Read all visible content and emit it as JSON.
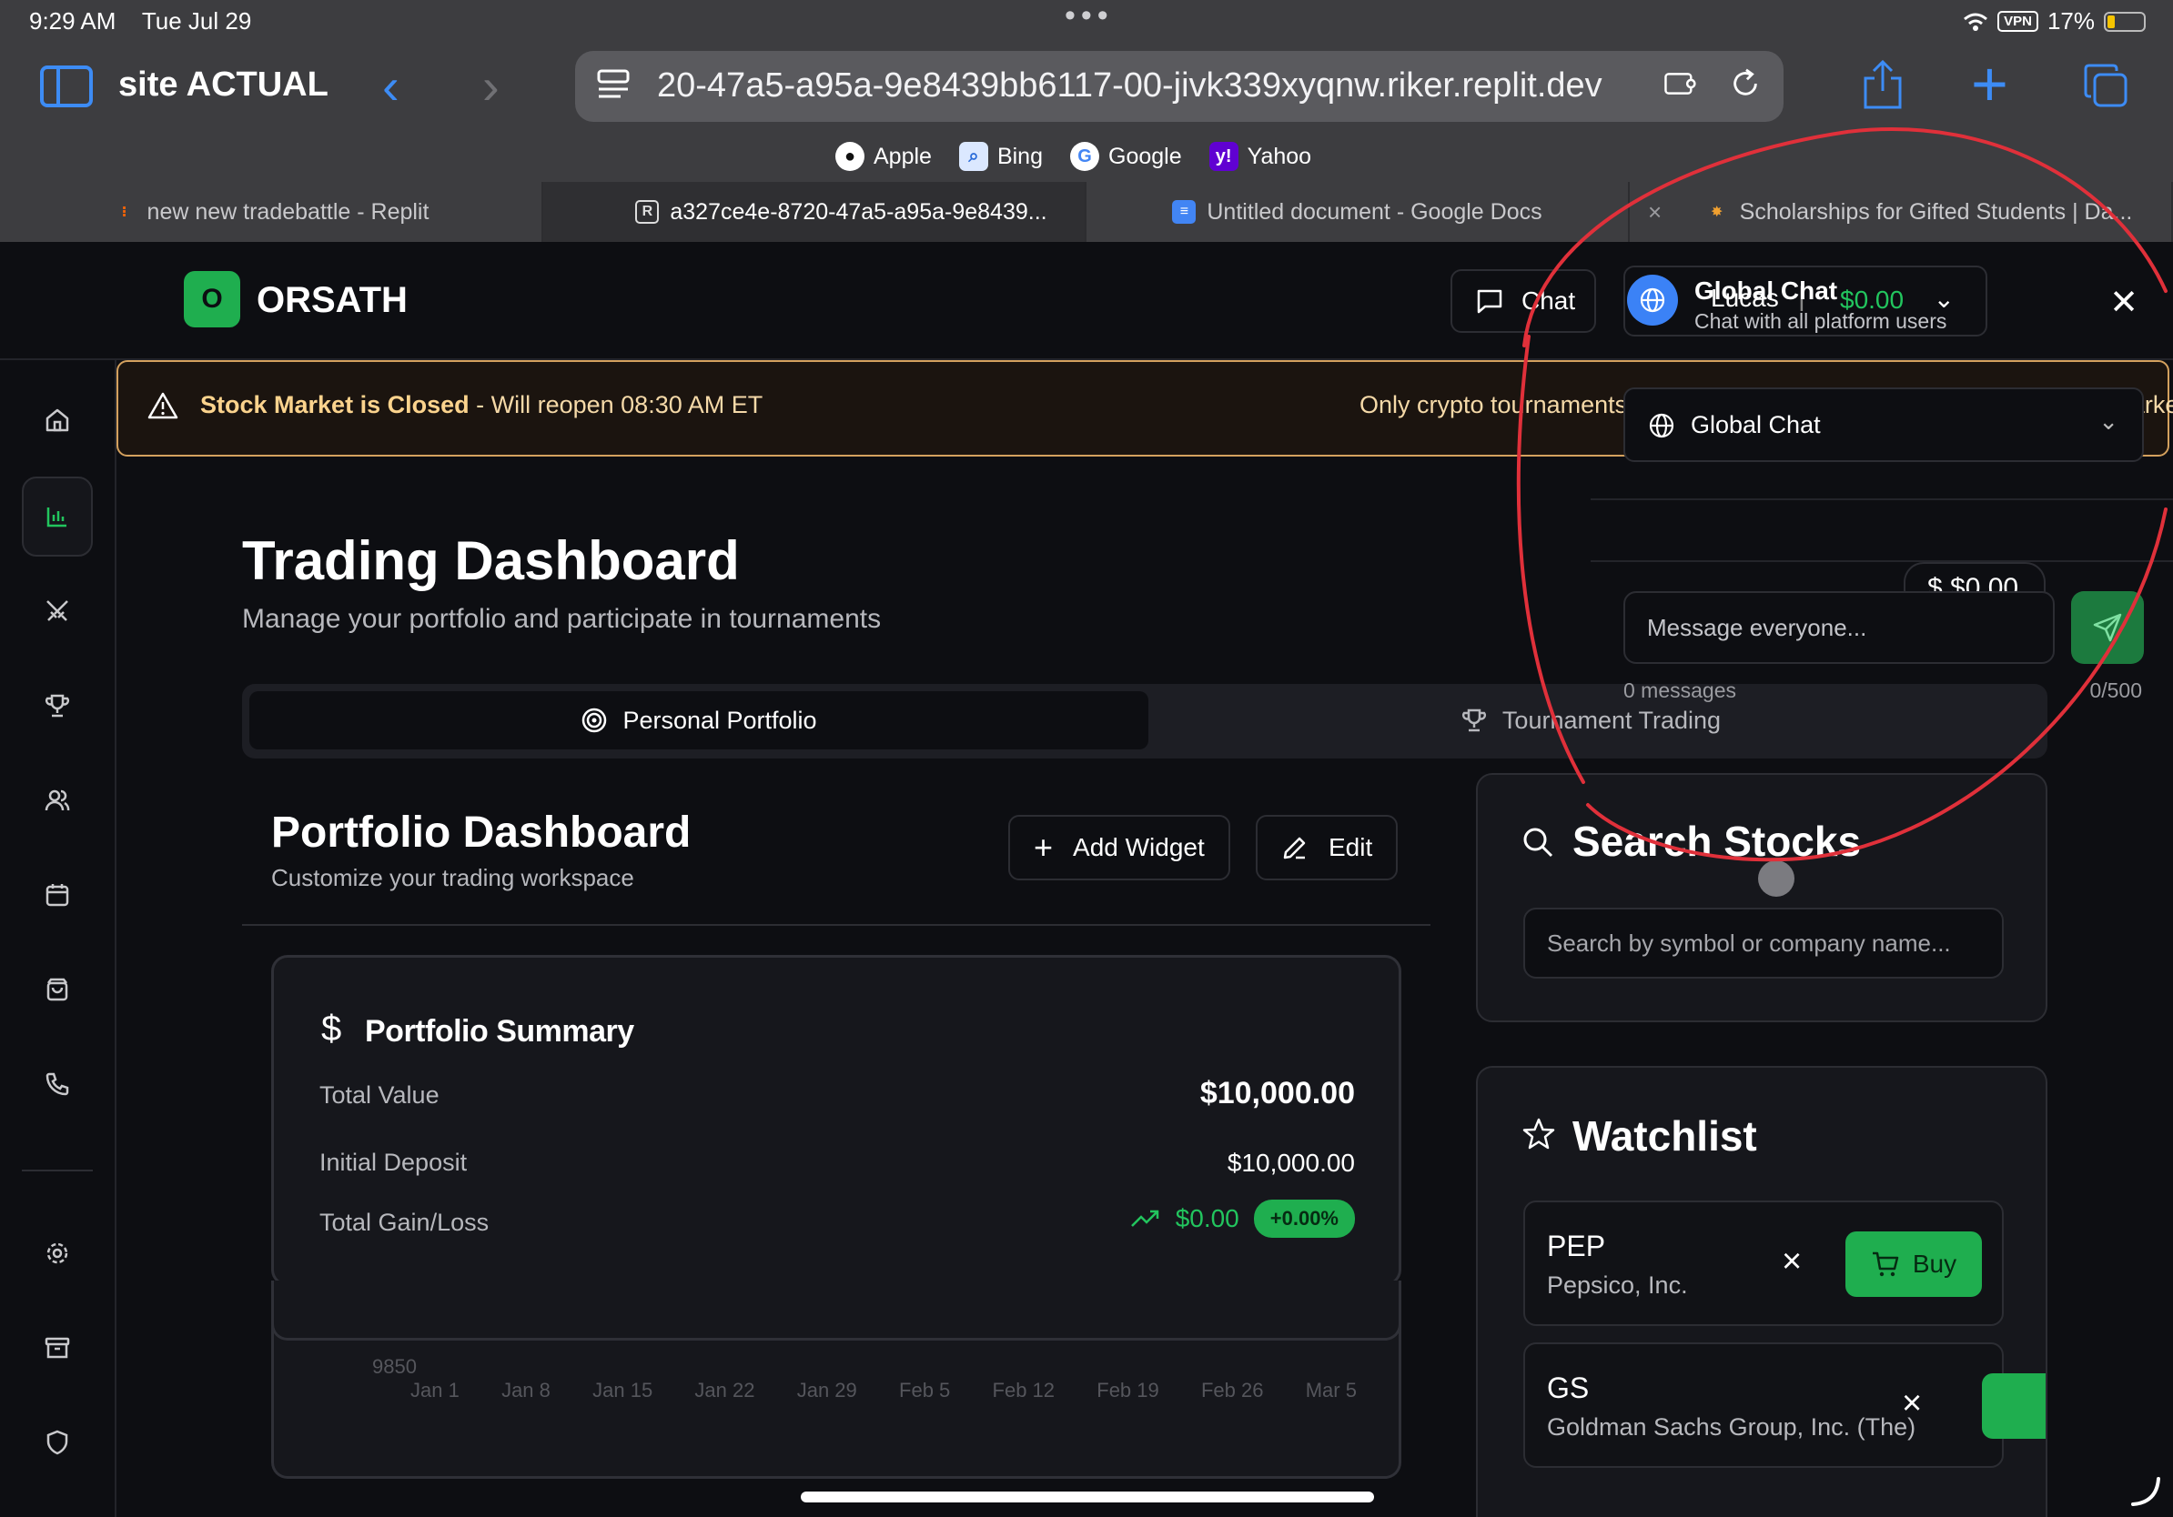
{
  "status_bar": {
    "time": "9:29 AM",
    "date": "Tue Jul 29",
    "dots": "•••",
    "vpn": "VPN",
    "battery": "17%"
  },
  "browser": {
    "site_title": "site ACTUAL",
    "url": "20-47a5-a95a-9e8439bb6117-00-jivk339xyqnw.riker.replit.dev",
    "bookmarks": [
      {
        "label": "Apple",
        "icon": "apple-icon"
      },
      {
        "label": "Bing",
        "icon": "bing-icon"
      },
      {
        "label": "Google",
        "icon": "google-icon"
      },
      {
        "label": "Yahoo",
        "icon": "yahoo-icon"
      }
    ],
    "tabs": [
      {
        "label": "new new tradebattle - Replit",
        "icon": "replit-icon"
      },
      {
        "label": "a327ce4e-8720-47a5-a95a-9e8439...",
        "icon": "replit-r-icon",
        "active": true
      },
      {
        "label": "Untitled document - Google Docs",
        "icon": "google-docs-icon"
      },
      {
        "label": "Scholarships for Gifted Students | Da...",
        "icon": "sparkle-icon"
      }
    ]
  },
  "app": {
    "logo_letter": "O",
    "logo_text": "ORSATH",
    "chat_button": "Chat",
    "user": {
      "name": "Lucas",
      "separator": "|",
      "balance": "$0.00"
    }
  },
  "banner": {
    "strong": "Stock Market is Closed",
    "rest": " - Will reopen 08:30 AM ET",
    "right": "Only crypto tournaments available. Stock tournaments scheduled for market open."
  },
  "page": {
    "title": "Trading Dashboard",
    "subtitle": "Manage your portfolio and participate in tournaments",
    "tabs": {
      "personal": "Personal Portfolio",
      "tournament": "Tournament Trading"
    }
  },
  "portfolio": {
    "title": "Portfolio Dashboard",
    "subtitle": "Customize your trading workspace",
    "add_widget": "Add Widget",
    "edit": "Edit",
    "summary": {
      "title": "Portfolio Summary",
      "total_value_label": "Total Value",
      "total_value": "$10,000.00",
      "initial_deposit_label": "Initial Deposit",
      "initial_deposit": "$10,000.00",
      "gain_label": "Total Gain/Loss",
      "gain_amount": "$0.00",
      "gain_pct": "+0.00%"
    }
  },
  "chart_data": {
    "type": "line",
    "x": [
      "Jan 1",
      "Jan 8",
      "Jan 15",
      "Jan 22",
      "Jan 29",
      "Feb 5",
      "Feb 12",
      "Feb 19",
      "Feb 26",
      "Mar 5"
    ],
    "y_tick": "9850",
    "series": []
  },
  "search": {
    "title": "Search Stocks",
    "placeholder": "Search by symbol or company name..."
  },
  "watchlist": {
    "title": "Watchlist",
    "buy_label": "Buy",
    "items": [
      {
        "symbol": "PEP",
        "company": "Pepsico, Inc."
      },
      {
        "symbol": "GS",
        "company": "Goldman Sachs Group, Inc. (The)"
      }
    ]
  },
  "chat": {
    "title": "Global Chat",
    "subtitle": "Chat with all platform users",
    "channel": "Global Chat",
    "balance": "$ $0.00",
    "placeholder": "Message everyone...",
    "count": "0 messages",
    "limit": "0/500"
  },
  "colors": {
    "accent_green": "#1fae4f",
    "gain_green": "#22c55e",
    "banner_border": "#d4a15e",
    "annotation_red": "#e0303a",
    "safari_blue": "#3d8cf5"
  }
}
